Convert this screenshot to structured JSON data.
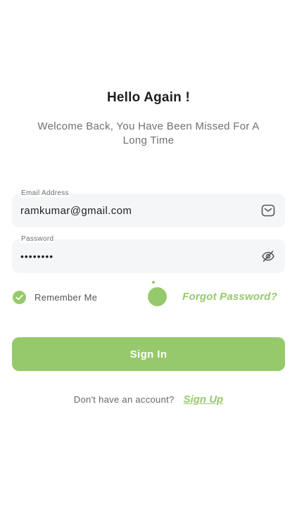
{
  "header": {
    "title": "Hello Again !",
    "subtitle": "Welcome Back, You Have Been Missed For A Long Time"
  },
  "form": {
    "email": {
      "label": "Email Address",
      "value": "ramkumar@gmail.com",
      "icon": "mail-icon"
    },
    "password": {
      "label": "Password",
      "value": "••••••••",
      "icon": "eye-off-icon"
    },
    "remember": {
      "label": "Remember Me",
      "checked": true
    },
    "forgot_label": "Forgot Password?",
    "signin_label": "Sign In"
  },
  "footer": {
    "prompt": "Don't have an account?",
    "signup_label": "Sign Up"
  },
  "colors": {
    "accent": "#96c96b",
    "field_bg": "#f5f6f8",
    "text": "#222222",
    "muted": "#707070"
  }
}
